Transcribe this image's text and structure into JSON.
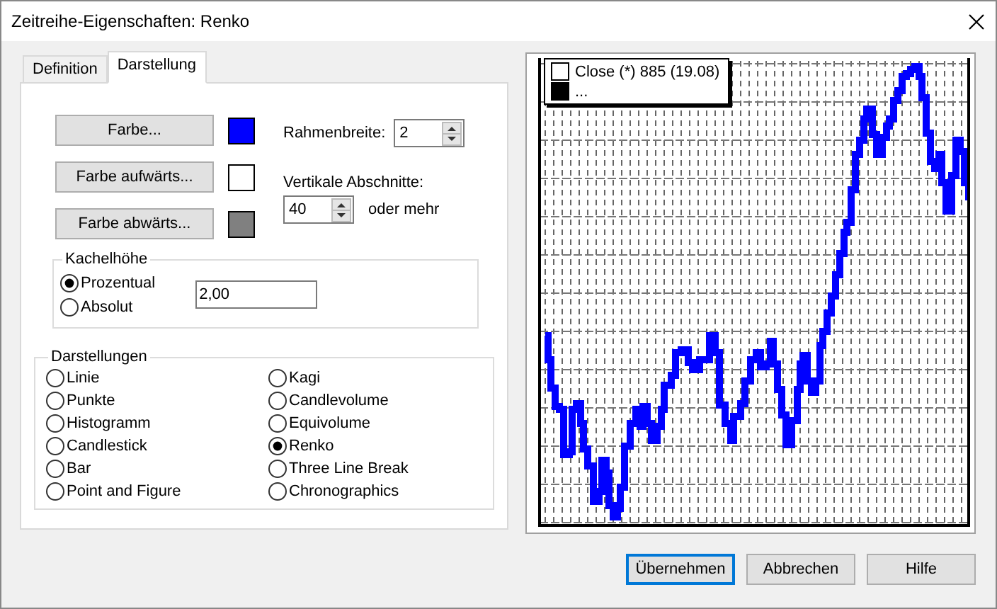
{
  "window": {
    "title": "Zeitreihe-Eigenschaften: Renko"
  },
  "tabs": [
    {
      "label": "Definition",
      "selected": false
    },
    {
      "label": "Darstellung",
      "selected": true
    }
  ],
  "color_buttons": [
    {
      "label": "Farbe...",
      "color": "#0000ff"
    },
    {
      "label": "Farbe aufwärts...",
      "color": "#ffffff"
    },
    {
      "label": "Farbe abwärts...",
      "color": "#808080"
    }
  ],
  "frame_width": {
    "label": "Rahmenbreite:",
    "value": "2"
  },
  "vertical_sections": {
    "label": "Vertikale Abschnitte:",
    "value": "40",
    "suffix": "oder mehr"
  },
  "tile_height": {
    "title": "Kachelhöhe",
    "value": "2,00",
    "options": [
      {
        "label": "Prozentual",
        "selected": true
      },
      {
        "label": "Absolut",
        "selected": false
      }
    ]
  },
  "styles": {
    "title": "Darstellungen",
    "options": [
      {
        "label": "Linie",
        "selected": false
      },
      {
        "label": "Punkte",
        "selected": false
      },
      {
        "label": "Histogramm",
        "selected": false
      },
      {
        "label": "Candlestick",
        "selected": false
      },
      {
        "label": "Bar",
        "selected": false
      },
      {
        "label": "Point and Figure",
        "selected": false
      },
      {
        "label": "Kagi",
        "selected": false
      },
      {
        "label": "Candlevolume",
        "selected": false
      },
      {
        "label": "Equivolume",
        "selected": false
      },
      {
        "label": "Renko",
        "selected": true
      },
      {
        "label": "Three Line Break",
        "selected": false
      },
      {
        "label": "Chronographics",
        "selected": false
      }
    ]
  },
  "preview": {
    "legend": [
      {
        "label": "Close (*) 885 (19.08)",
        "color": "#ffffff"
      },
      {
        "label": "...",
        "color": "#000000"
      }
    ]
  },
  "buttons": [
    {
      "label": "Übernehmen",
      "default": true
    },
    {
      "label": "Abbrechen",
      "default": false
    },
    {
      "label": "Hilfe",
      "default": false
    }
  ]
}
